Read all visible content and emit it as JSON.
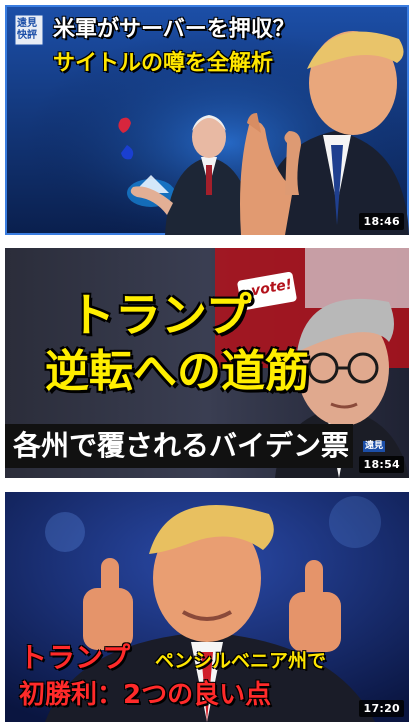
{
  "feed": {
    "videos": [
      {
        "logo_lines": [
          "遠見",
          "快評"
        ],
        "title_line1": "米軍がサーバーを押収？",
        "title_line2": "サイトルの噂を全解析",
        "duration": "18:46",
        "colors": {
          "bg_top": "#1c4fa8",
          "bg_bottom": "#0a1f4d",
          "title1": "#ffffff",
          "title2": "#ffe600",
          "border": "#3a7de0"
        }
      },
      {
        "title_line1": "トランプ",
        "title_line2": "逆転への道筋",
        "title_line3": "各州で覆されるバイデン票",
        "sign_text": "vote!",
        "logo_text": "遠見",
        "duration": "18:54",
        "colors": {
          "title_yellow": "#ffee00",
          "banner_bg": "#111111",
          "banner_text": "#ffffff",
          "bg_red": "#b3121b"
        }
      },
      {
        "title_part1": "トランプ",
        "title_part2": "ペンシルベニア州で",
        "title_line2": "初勝利：2つの良い点",
        "duration": "17:20",
        "colors": {
          "red": "#ff2a2a",
          "yellow": "#ffe600",
          "bg": "#0a1540"
        }
      }
    ]
  }
}
